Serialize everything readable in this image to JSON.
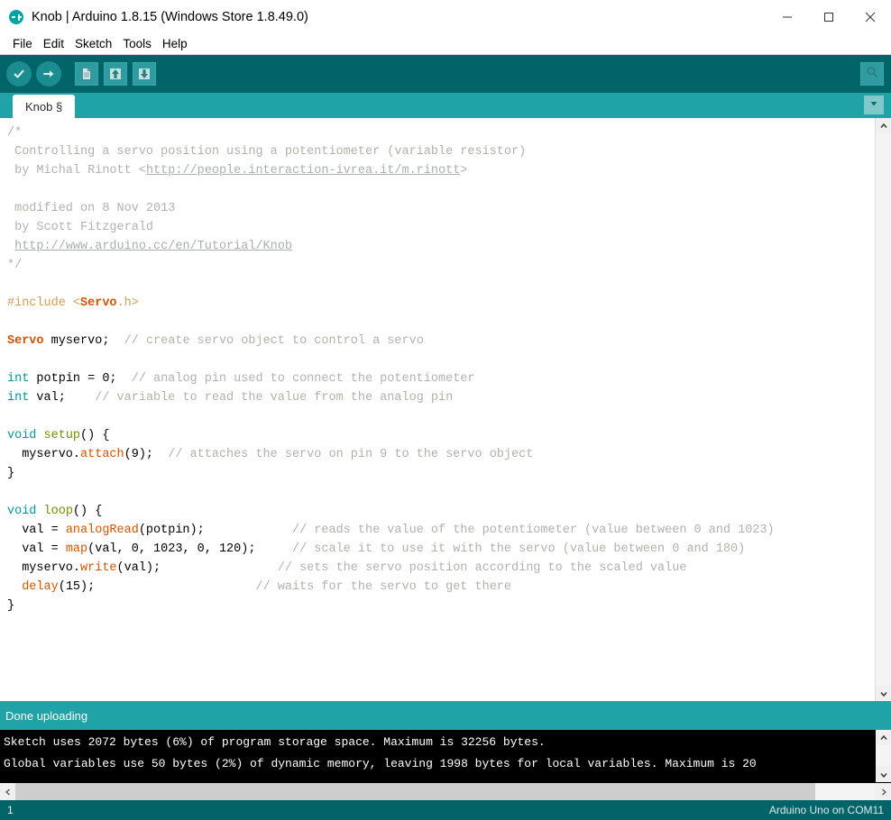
{
  "window": {
    "title": "Knob | Arduino 1.8.15 (Windows Store 1.8.49.0)",
    "logo_icon": "arduino-logo-icon",
    "minimize_icon": "minimize-icon",
    "maximize_icon": "maximize-icon",
    "close_icon": "close-icon"
  },
  "menubar": {
    "items": [
      {
        "label": "File"
      },
      {
        "label": "Edit"
      },
      {
        "label": "Sketch"
      },
      {
        "label": "Tools"
      },
      {
        "label": "Help"
      }
    ]
  },
  "toolbar": {
    "verify_label": "Verify",
    "verify_icon": "check-circle-icon",
    "upload_label": "Upload",
    "upload_icon": "arrow-right-circle-icon",
    "new_label": "New",
    "new_icon": "new-document-icon",
    "open_label": "Open",
    "open_icon": "arrow-up-icon",
    "save_label": "Save",
    "save_icon": "arrow-down-icon",
    "serial_monitor_label": "Serial Monitor",
    "serial_monitor_icon": "magnifier-icon"
  },
  "tabs": {
    "items": [
      {
        "label": "Knob §"
      }
    ],
    "menu_icon": "chevron-down-icon"
  },
  "editor": {
    "lines": [
      [
        {
          "t": "/*",
          "c": "cmt"
        }
      ],
      [
        {
          "t": " Controlling a servo position using a potentiometer (variable resistor)",
          "c": "cmt"
        }
      ],
      [
        {
          "t": " by Michal Rinott <",
          "c": "cmt"
        },
        {
          "t": "http://people.interaction-ivrea.it/m.rinott",
          "c": "cmt-link"
        },
        {
          "t": ">",
          "c": "cmt"
        }
      ],
      [
        {
          "t": "",
          "c": "cmt"
        }
      ],
      [
        {
          "t": " modified on 8 Nov 2013",
          "c": "cmt"
        }
      ],
      [
        {
          "t": " by Scott Fitzgerald",
          "c": "cmt"
        }
      ],
      [
        {
          "t": " ",
          "c": "cmt"
        },
        {
          "t": "http://www.arduino.cc/en/Tutorial/Knob",
          "c": "cmt-link"
        }
      ],
      [
        {
          "t": "*/",
          "c": "cmt"
        }
      ],
      [
        {
          "t": "",
          "c": ""
        }
      ],
      [
        {
          "t": "#include ",
          "c": "pre"
        },
        {
          "t": "<",
          "c": "pre"
        },
        {
          "t": "Servo",
          "c": "kw2"
        },
        {
          "t": ".h>",
          "c": "pre"
        }
      ],
      [
        {
          "t": "",
          "c": ""
        }
      ],
      [
        {
          "t": "Servo",
          "c": "kw2"
        },
        {
          "t": " myservo;  ",
          "c": ""
        },
        {
          "t": "// create servo object to control a servo",
          "c": "cmt"
        }
      ],
      [
        {
          "t": "",
          "c": ""
        }
      ],
      [
        {
          "t": "int",
          "c": "kw"
        },
        {
          "t": " potpin = 0;  ",
          "c": ""
        },
        {
          "t": "// analog pin used to connect the potentiometer",
          "c": "cmt"
        }
      ],
      [
        {
          "t": "int",
          "c": "kw"
        },
        {
          "t": " val;    ",
          "c": ""
        },
        {
          "t": "// variable to read the value from the analog pin",
          "c": "cmt"
        }
      ],
      [
        {
          "t": "",
          "c": ""
        }
      ],
      [
        {
          "t": "void",
          "c": "kw"
        },
        {
          "t": " ",
          "c": ""
        },
        {
          "t": "setup",
          "c": "fn"
        },
        {
          "t": "() {",
          "c": ""
        }
      ],
      [
        {
          "t": "  myservo.",
          "c": ""
        },
        {
          "t": "attach",
          "c": "func"
        },
        {
          "t": "(9);  ",
          "c": ""
        },
        {
          "t": "// attaches the servo on pin 9 to the servo object",
          "c": "cmt"
        }
      ],
      [
        {
          "t": "}",
          "c": ""
        }
      ],
      [
        {
          "t": "",
          "c": ""
        }
      ],
      [
        {
          "t": "void",
          "c": "kw"
        },
        {
          "t": " ",
          "c": ""
        },
        {
          "t": "loop",
          "c": "fn"
        },
        {
          "t": "() {",
          "c": ""
        }
      ],
      [
        {
          "t": "  val = ",
          "c": ""
        },
        {
          "t": "analogRead",
          "c": "func"
        },
        {
          "t": "(potpin);            ",
          "c": ""
        },
        {
          "t": "// reads the value of the potentiometer (value between 0 and 1023)",
          "c": "cmt"
        }
      ],
      [
        {
          "t": "  val = ",
          "c": ""
        },
        {
          "t": "map",
          "c": "func"
        },
        {
          "t": "(val, 0, 1023, 0, 120);     ",
          "c": ""
        },
        {
          "t": "// scale it to use it with the servo (value between 0 and 180)",
          "c": "cmt"
        }
      ],
      [
        {
          "t": "  myservo.",
          "c": ""
        },
        {
          "t": "write",
          "c": "func"
        },
        {
          "t": "(val);                ",
          "c": ""
        },
        {
          "t": "// sets the servo position according to the scaled value",
          "c": "cmt"
        }
      ],
      [
        {
          "t": "  ",
          "c": ""
        },
        {
          "t": "delay",
          "c": "func"
        },
        {
          "t": "(15);                      ",
          "c": ""
        },
        {
          "t": "// waits for the servo to get there",
          "c": "cmt"
        }
      ],
      [
        {
          "t": "}",
          "c": ""
        }
      ]
    ],
    "scroll_up_icon": "chevron-up-icon",
    "scroll_down_icon": "chevron-down-icon"
  },
  "status": {
    "message": "Done uploading"
  },
  "console": {
    "lines": [
      "Sketch uses 2072 bytes (6%) of program storage space. Maximum is 32256 bytes.",
      "Global variables use 50 bytes (2%) of dynamic memory, leaving 1998 bytes for local variables. Maximum is 20"
    ],
    "scroll_up_icon": "chevron-up-icon",
    "scroll_down_icon": "chevron-down-icon",
    "hscroll_left_icon": "chevron-left-icon",
    "hscroll_right_icon": "chevron-right-icon"
  },
  "bottombar": {
    "line_number": "1",
    "board_info": "Arduino Uno on COM11"
  },
  "colors": {
    "toolbar_dark_teal": "#006468",
    "tabbar_teal": "#1fa3a6",
    "console_bg": "#000000",
    "comment_gray": "#b0b3ab",
    "keyword_teal": "#00979c",
    "function_orange": "#d35400",
    "preproc_tan": "#d79b59",
    "method_green": "#728e00"
  }
}
